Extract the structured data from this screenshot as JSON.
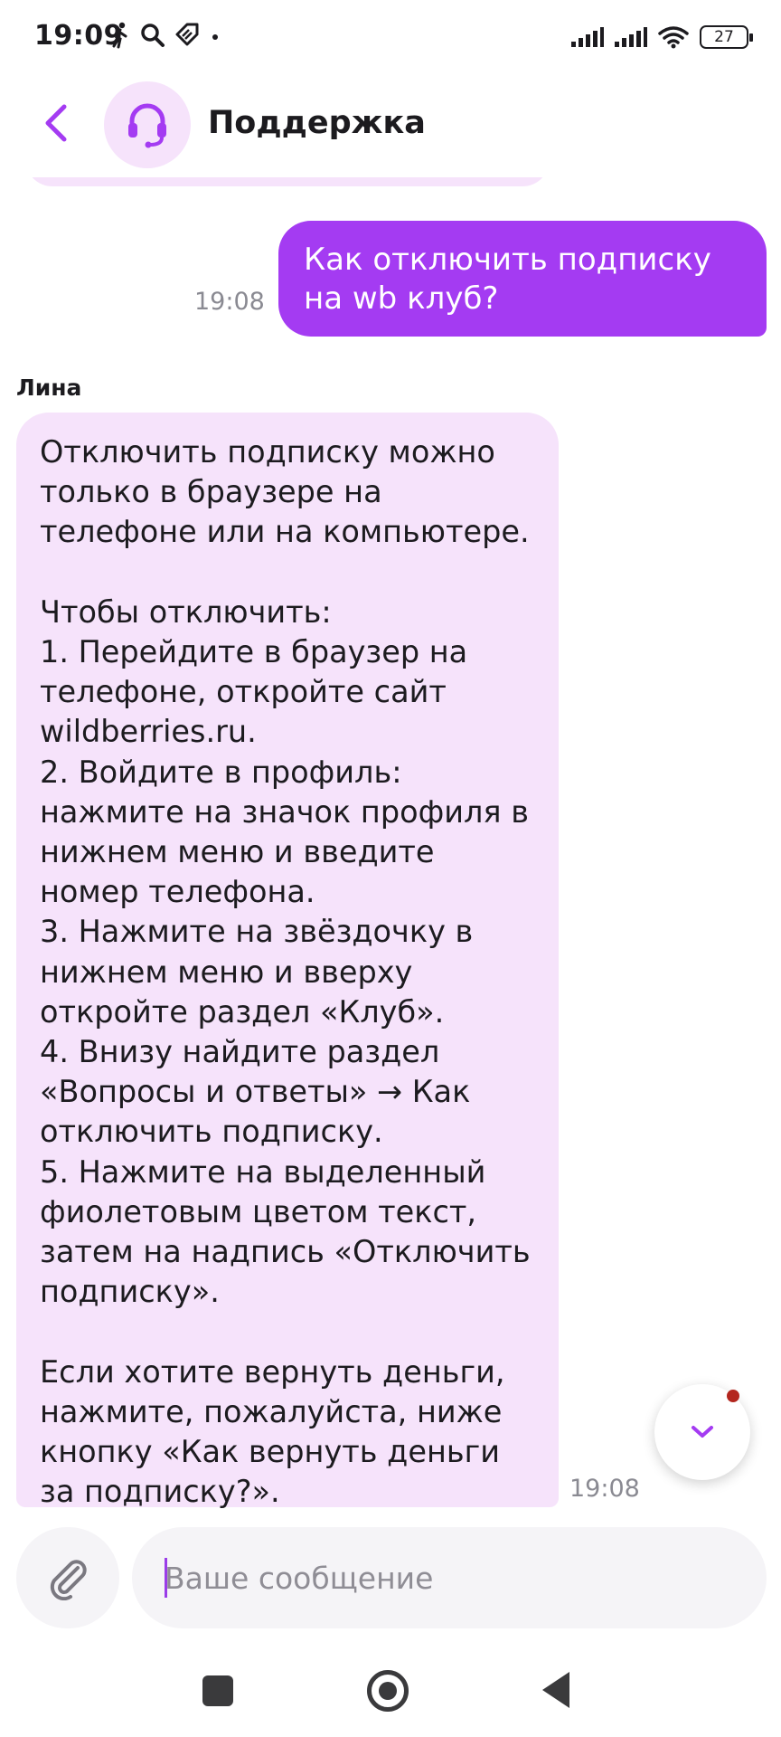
{
  "status_bar": {
    "time": "19:09",
    "battery": "27"
  },
  "header": {
    "title": "Поддержка"
  },
  "messages": {
    "outgoing": {
      "text": "Как отключить подписку на wb клуб?",
      "time": "19:08"
    },
    "incoming": {
      "sender": "Лина",
      "text": "Отключить подписку можно только в браузере на телефоне или на компьютере.\n\nЧтобы отключить:\n1. Перейдите в браузер на телефоне, откройте сайт wildberries.ru.\n2. Войдите в профиль: нажмите на значок профиля в нижнем меню и введите номер телефона.\n3. Нажмите на звёздочку в нижнем меню и вверху откройте раздел «Клуб».\n4. Внизу найдите раздел «Вопросы и ответы» → Как отключить подписку.\n5. Нажмите на выделенный фиолетовым цветом текст, затем на надпись «Отключить подписку».\n\nЕсли хотите вернуть деньги, нажмите, пожалуйста, ниже кнопку «Как вернуть деньги за подписку?».",
      "time": "19:08"
    }
  },
  "composer": {
    "placeholder": "Ваше сообщение"
  },
  "icons": {
    "back": "chevron-left-icon",
    "avatar": "headset-icon",
    "scroll_down": "chevron-down-icon",
    "attach": "paperclip-icon"
  },
  "colors": {
    "accent": "#a43bf2",
    "incoming_bubble": "#f6e3fb",
    "unread_dot": "#b3261e"
  }
}
